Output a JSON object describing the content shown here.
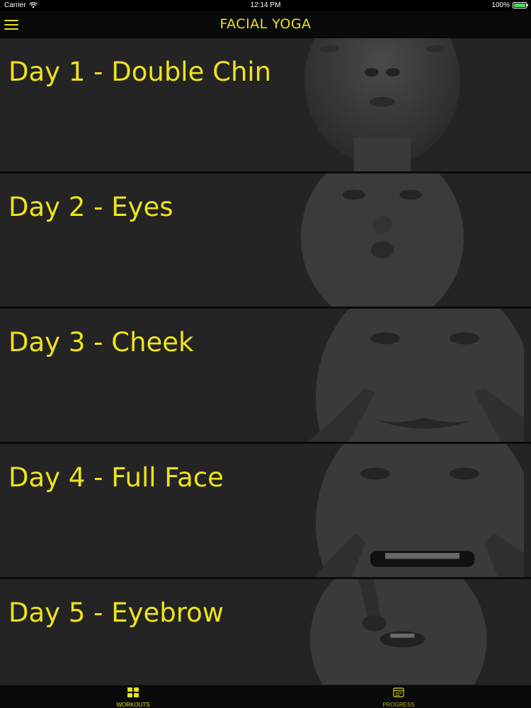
{
  "status_bar": {
    "carrier": "Carrier",
    "time": "12:14 PM",
    "battery": "100%"
  },
  "nav": {
    "title": "FACIAL YOGA",
    "menu_icon": "hamburger-menu-icon"
  },
  "workouts": [
    {
      "label": "Day 1 - Double Chin"
    },
    {
      "label": "Day 2 - Eyes"
    },
    {
      "label": "Day 3 - Cheek"
    },
    {
      "label": "Day 4 - Full Face"
    },
    {
      "label": "Day 5 - Eyebrow"
    }
  ],
  "tabs": [
    {
      "label": "WORKOUTS",
      "icon": "grid-icon",
      "selected": true
    },
    {
      "label": "PROGRESS",
      "icon": "calendar-icon",
      "selected": false
    }
  ],
  "colors": {
    "accent": "#e8e21a",
    "background": "#000000",
    "card": "#242424"
  }
}
